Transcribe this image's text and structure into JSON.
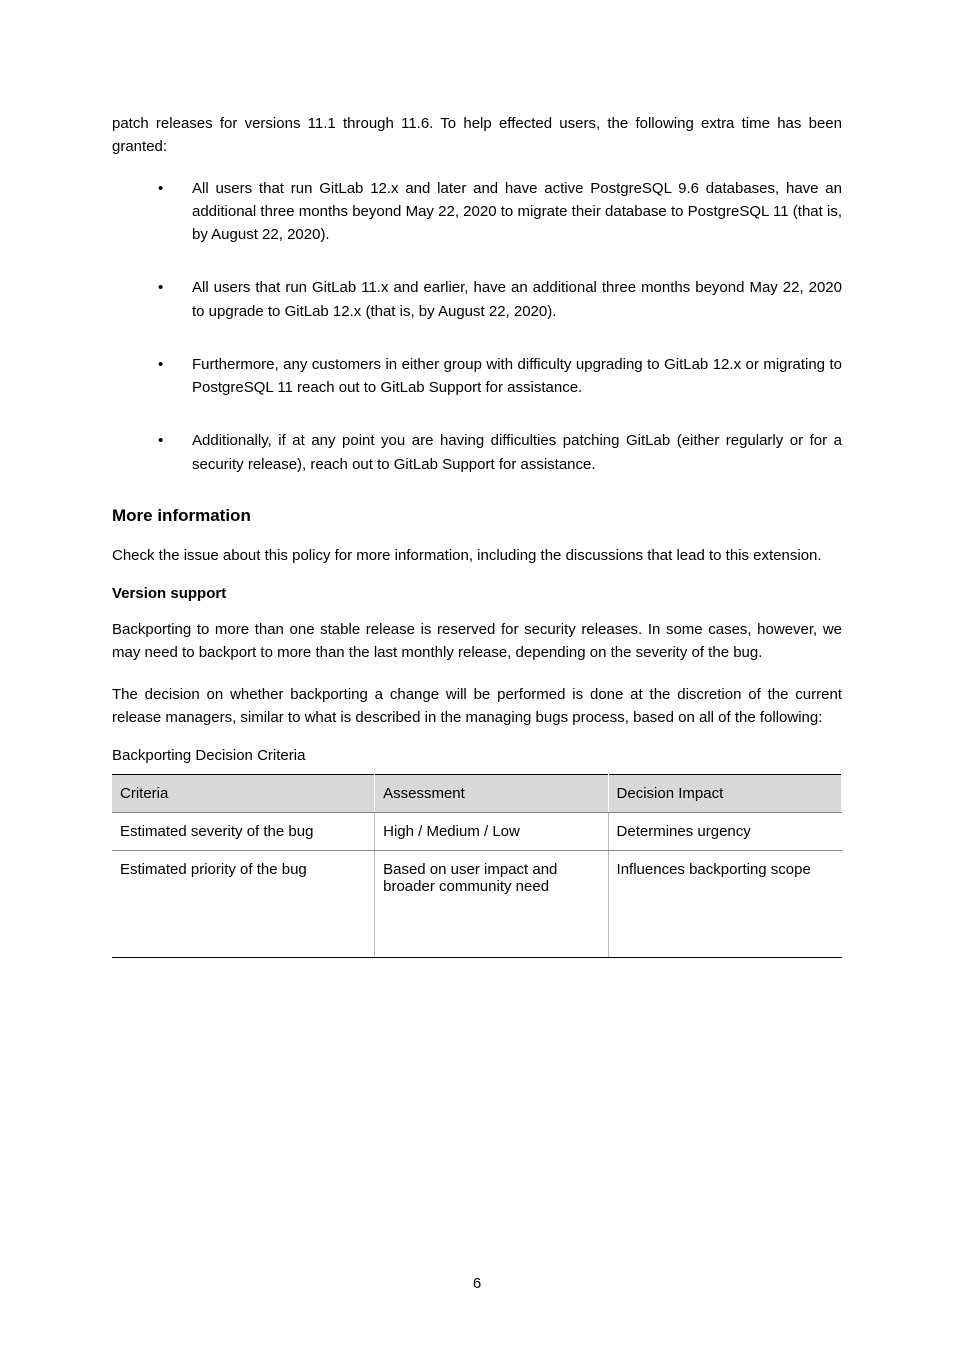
{
  "intro": "patch releases for versions 11.1 through 11.6. To help effected users, the following extra time has been granted:",
  "bullets": [
    "All users that run GitLab 12.x and later and have active PostgreSQL 9.6 databases, have an additional three months beyond May 22, 2020 to migrate their database to PostgreSQL 11 (that is, by August 22, 2020).",
    "All users that run GitLab 11.x and earlier, have an additional three months beyond May 22, 2020 to upgrade to GitLab 12.x (that is, by August 22, 2020).",
    "Furthermore, any customers in either group with difficulty upgrading to GitLab 12.x or migrating to PostgreSQL 11 reach out to GitLab Support for assistance.",
    "Additionally, if at any point you are having difficulties patching GitLab (either regularly or for a security release), reach out to GitLab Support for assistance."
  ],
  "heading_more": "More information",
  "more_text": "Check the issue about this policy for more information, including the discussions that lead to this extension.",
  "heading_version": "Version support",
  "version_para1": "Backporting to more than one stable release is reserved for security releases. In some cases, however, we may need to backport to more than the last monthly release, depending on the severity of the bug.",
  "version_para2": "The decision on whether backporting a change will be performed is done at the discretion of the current release managers, similar to what is described in the managing bugs process, based on all of the following:",
  "caption": "Backporting Decision Criteria",
  "table": {
    "headers": [
      "Criteria",
      "Assessment",
      "Decision Impact"
    ],
    "rows": [
      [
        "Estimated severity of the bug",
        "High / Medium / Low",
        "Determines urgency"
      ],
      [
        "Estimated priority of the bug",
        "Based on user impact and broader community need",
        "Influences backporting scope"
      ]
    ]
  },
  "footer_page": "6"
}
